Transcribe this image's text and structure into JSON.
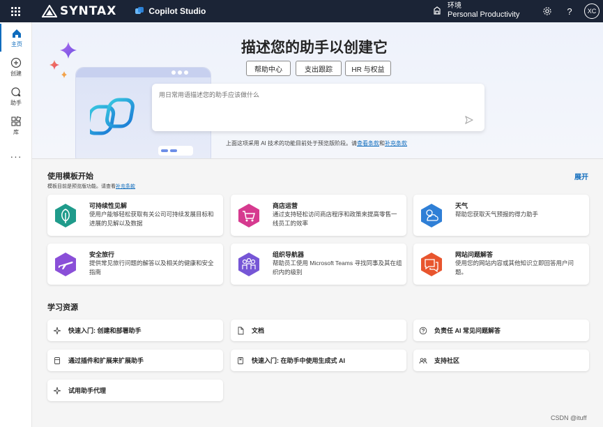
{
  "topbar": {
    "brand": "SYNTAX",
    "product": "Copilot Studio",
    "env_label": "环境",
    "env_value": "Personal Productivity",
    "avatar_initials": "XC"
  },
  "rail": {
    "items": [
      {
        "label": "主页",
        "icon": "home-icon"
      },
      {
        "label": "创建",
        "icon": "add-circle-icon"
      },
      {
        "label": "助手",
        "icon": "bot-icon"
      },
      {
        "label": "库",
        "icon": "library-icon"
      }
    ],
    "more": "···"
  },
  "hero": {
    "title": "描述您的助手以创建它",
    "buttons": [
      "帮助中心",
      "支出跟踪",
      "HR 与权益"
    ],
    "placeholder": "用日常用语描述您的助手应该做什么",
    "disclaimer_prefix": "上面这项采用 AI 技术的功能目前处于预览版阶段。请",
    "disclaimer_link1": "查看条款",
    "disclaimer_and": "和",
    "disclaimer_link2": "补充条款"
  },
  "templates": {
    "title": "使用模板开始",
    "sub_prefix": "模板目前是预览版功能。请查看",
    "sub_link": "补充条款",
    "expand": "展开",
    "cards": [
      {
        "title": "可持续性见解",
        "desc": "使用户能够轻松获取有关公司可持续发展目标和进展的见解以及数据",
        "icon": "leaf-icon",
        "color": "#1f9b8b"
      },
      {
        "title": "商店运营",
        "desc": "通过支持轻松访问商店程序和政策来提高零售一线员工的效率",
        "icon": "cart-icon",
        "color": "#d63a8f"
      },
      {
        "title": "天气",
        "desc": "帮助您获取天气预报的得力助手",
        "icon": "weather-icon",
        "color": "#2f7fd6"
      },
      {
        "title": "安全旅行",
        "desc": "提供常见旅行问题的解答以及相关的健康和安全指南",
        "icon": "plane-icon",
        "color": "#8a4fd8"
      },
      {
        "title": "组织导航器",
        "desc": "帮助员工使用 Microsoft Teams 寻找同事及其在组织内的级别",
        "icon": "people-icon",
        "color": "#7656d6"
      },
      {
        "title": "网站问题解答",
        "desc": "使用您的网站内容或其他知识立即回答用户问题。",
        "icon": "chat-help-icon",
        "color": "#e8552e"
      }
    ]
  },
  "learning": {
    "title": "学习资源",
    "items": [
      {
        "label": "快速入门: 创建和部署助手",
        "icon": "sparkle-icon"
      },
      {
        "label": "文档",
        "icon": "document-icon"
      },
      {
        "label": "负责任 AI 常见问题解答",
        "icon": "chat-question-icon"
      },
      {
        "label": "通过插件和扩展来扩展助手",
        "icon": "plugin-icon"
      },
      {
        "label": "快速入门: 在助手中使用生成式 AI",
        "icon": "book-icon"
      },
      {
        "label": "支持社区",
        "icon": "community-icon"
      },
      {
        "label": "试用助手代理",
        "icon": "sparkle-icon"
      }
    ]
  },
  "watermark": "CSDN @ituff",
  "colors": {
    "topbar": "#1b2436",
    "accent": "#0f6cbd"
  }
}
